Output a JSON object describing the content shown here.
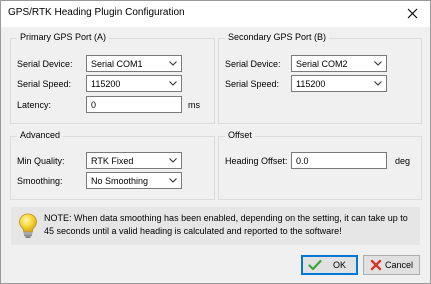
{
  "window": {
    "title": "GPS/RTK Heading Plugin Configuration",
    "close_icon": "close-icon"
  },
  "primary": {
    "legend": "Primary GPS Port (A)",
    "serial_device_label": "Serial Device:",
    "serial_device_value": "Serial COM1",
    "serial_speed_label": "Serial Speed:",
    "serial_speed_value": "115200",
    "latency_label": "Latency:",
    "latency_value": "0",
    "latency_unit": "ms"
  },
  "secondary": {
    "legend": "Secondary GPS Port (B)",
    "serial_device_label": "Serial Device:",
    "serial_device_value": "Serial COM2",
    "serial_speed_label": "Serial Speed:",
    "serial_speed_value": "115200"
  },
  "advanced": {
    "legend": "Advanced",
    "min_quality_label": "Min Quality:",
    "min_quality_value": "RTK Fixed",
    "smoothing_label": "Smoothing:",
    "smoothing_value": "No Smoothing"
  },
  "offset": {
    "legend": "Offset",
    "heading_offset_label": "Heading Offset:",
    "heading_offset_value": "0.0",
    "heading_offset_unit": "deg"
  },
  "note": {
    "icon": "lightbulb-icon",
    "line1": "NOTE: When data smoothing has been enabled, depending on the setting, it can take up to",
    "line2": "45 seconds until a valid heading is calculated and reported to the software!"
  },
  "buttons": {
    "ok_label": "OK",
    "ok_icon": "checkmark-icon",
    "cancel_label": "Cancel",
    "cancel_icon": "cross-icon"
  },
  "colors": {
    "window_bg": "#f0f0f0",
    "ok_check": "#3aa53a",
    "cancel_cross": "#d9362b",
    "default_button_border": "#0078d7"
  }
}
